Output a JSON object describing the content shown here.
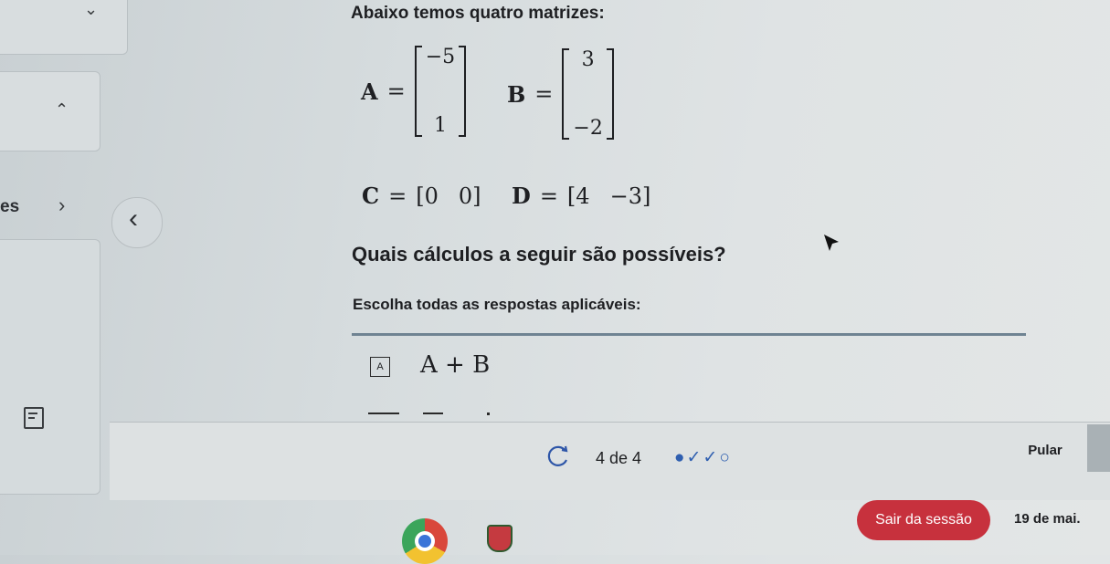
{
  "intro": "Abaixo temos quatro matrizes:",
  "matrices": {
    "A": {
      "label": "A",
      "eq": "=",
      "top": "−5",
      "bottom": "1"
    },
    "B": {
      "label": "B",
      "eq": "=",
      "top": "3",
      "bottom": "−2"
    },
    "C": {
      "label": "C",
      "eq": "=",
      "open": "[",
      "v1": "0",
      "v2": "0",
      "close": "]"
    },
    "D": {
      "label": "D",
      "eq": "=",
      "open": "[",
      "v1": "4",
      "v2": "−3",
      "close": "]"
    }
  },
  "question": "Quais cálculos a seguir são possíveis?",
  "instruction": "Escolha todas as respostas aplicáveis:",
  "options": [
    {
      "letter": "A",
      "expr": "A + B"
    }
  ],
  "sidebar": {
    "partial_text": "es"
  },
  "footer": {
    "progress": "4 de 4",
    "progress_marks": "●✓✓○",
    "skip": "Pular",
    "exit": "Sair da sessão",
    "date": "19 de mai."
  }
}
